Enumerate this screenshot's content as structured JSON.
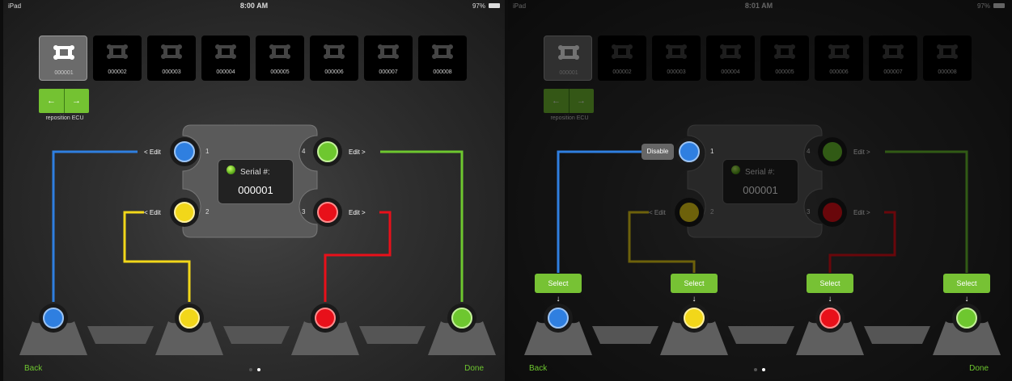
{
  "colors": {
    "blue": "#2f7fe0",
    "yellow": "#f2d71a",
    "red": "#e8101a",
    "green": "#6ec72f",
    "accent": "#74c232"
  },
  "left": {
    "status": {
      "carrier": "iPad",
      "time": "8:00 AM",
      "battery": "97%"
    },
    "ecus": [
      "000001",
      "000002",
      "000003",
      "000004",
      "000005",
      "000006",
      "000007",
      "000008"
    ],
    "selected_ecu": 0,
    "reposition": {
      "left_arrow": "←",
      "right_arrow": "→",
      "label": "reposition ECU"
    },
    "serial": {
      "title": "Serial #:",
      "value": "000001"
    },
    "pins": {
      "p1": {
        "num": "1",
        "label": "< Edit"
      },
      "p2": {
        "num": "2",
        "label": "< Edit"
      },
      "p3": {
        "num": "3",
        "label": "Edit >"
      },
      "p4": {
        "num": "4",
        "label": "Edit >"
      }
    },
    "nav": {
      "back": "Back",
      "done": "Done"
    }
  },
  "right": {
    "status": {
      "carrier": "iPad",
      "time": "8:01 AM",
      "battery": "97%"
    },
    "ecus": [
      "000001",
      "000002",
      "000003",
      "000004",
      "000005",
      "000006",
      "000007",
      "000008"
    ],
    "reposition": {
      "left_arrow": "←",
      "right_arrow": "→",
      "label": "reposition ECU"
    },
    "serial": {
      "title": "Serial #:",
      "value": "000001"
    },
    "pins": {
      "p1": {
        "num": "1",
        "label": "Disable"
      },
      "p2": {
        "num": "2",
        "label": "< Edit"
      },
      "p3": {
        "num": "3",
        "label": "Edit >"
      },
      "p4": {
        "num": "4",
        "label": "Edit >"
      }
    },
    "select_label": "Select",
    "select_arrow": "↓",
    "nav": {
      "back": "Back",
      "done": "Done"
    }
  }
}
